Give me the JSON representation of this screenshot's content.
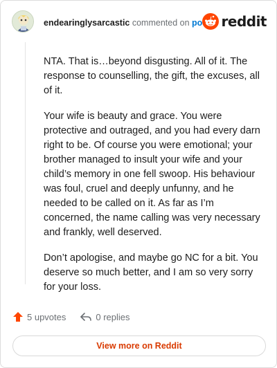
{
  "comment": {
    "author": "endearinglysarcastic",
    "action": "commented on",
    "target_link": "post",
    "paragraphs": [
      "NTA. That is…beyond disgusting. All of it. The response to counselling, the gift, the excuses, all of it.",
      "Your wife is beauty and grace. You were protective and outraged, and you had every darn right to be. Of course you were emotional; your brother managed to insult your wife and your child’s memory in one fell swoop. His behaviour was foul, cruel and deeply unfunny, and he needed to be called on it. As far as I’m concerned, the name calling was very necessary and frankly, well deserved.",
      "Don’t apologise, and maybe go NC for a bit. You deserve so much better, and I am so very sorry for your loss."
    ]
  },
  "brand": {
    "wordmark": "reddit",
    "color": "#ff4500"
  },
  "footer": {
    "upvotes_label": "5 upvotes",
    "replies_label": "0 replies",
    "upvote_color": "#ff4500"
  },
  "cta": {
    "label": "View more on Reddit",
    "color": "#d93a00"
  }
}
